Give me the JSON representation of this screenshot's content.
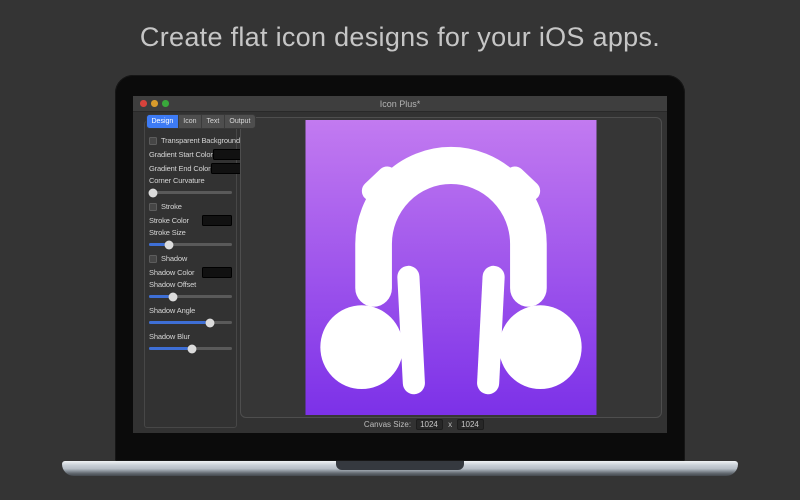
{
  "page": {
    "headline": "Create flat icon designs for your iOS apps."
  },
  "window": {
    "title": "Icon Plus*",
    "traffic_lights": [
      {
        "name": "close",
        "color": "#d8433c"
      },
      {
        "name": "minimize",
        "color": "#d89b2c"
      },
      {
        "name": "zoom",
        "color": "#39a83b"
      }
    ],
    "titlebar_bg": "#3e3e3e"
  },
  "tabs": [
    {
      "label": "Design",
      "selected": true
    },
    {
      "label": "Icon",
      "selected": false
    },
    {
      "label": "Text",
      "selected": false
    },
    {
      "label": "Output",
      "selected": false
    }
  ],
  "sidebar": {
    "rows": [
      {
        "type": "checkbox",
        "label": "Transparent Background",
        "checked": false
      },
      {
        "type": "colorwell",
        "label": "Gradient Start Color",
        "color": "#c06ef2"
      },
      {
        "type": "colorwell",
        "label": "Gradient End Color",
        "color": "#8a3cf2"
      },
      {
        "type": "slider",
        "label": "Corner Curvature",
        "percent": 5
      },
      {
        "type": "checkbox",
        "label": "Stroke",
        "checked": false
      },
      {
        "type": "colorwell",
        "label": "Stroke Color",
        "color": "#ffffff"
      },
      {
        "type": "slider",
        "label": "Stroke Size",
        "percent": 24
      },
      {
        "type": "checkbox",
        "label": "Shadow",
        "checked": false
      },
      {
        "type": "colorwell",
        "label": "Shadow Color",
        "color": "#0d0d0d"
      },
      {
        "type": "slider",
        "label": "Shadow Offset",
        "percent": 29
      },
      {
        "type": "slider",
        "label": "Shadow Angle",
        "percent": 74
      },
      {
        "type": "slider",
        "label": "Shadow Blur",
        "percent": 52
      }
    ],
    "accent_color": "#3d7bf5",
    "slider_fill_color": "#3e6fd6"
  },
  "canvas": {
    "icon": "headphones",
    "icon_color": "#ffffff",
    "gradient_start": "#c27af0",
    "gradient_end": "#7c31e8"
  },
  "footer": {
    "canvas_size_label": "Canvas Size:",
    "width_value": "1024",
    "separator": "x",
    "height_value": "1024"
  }
}
